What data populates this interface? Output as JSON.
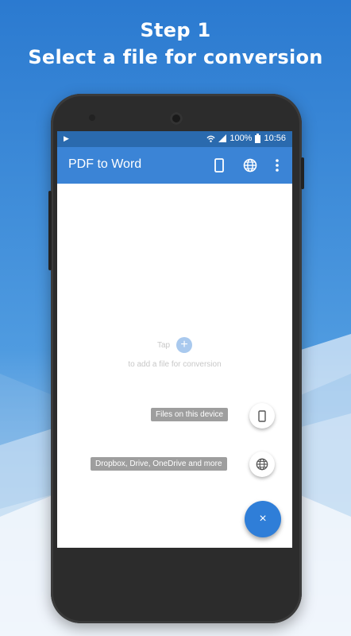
{
  "promo": {
    "step": "Step 1",
    "tagline": "Select a file for conversion"
  },
  "statusbar": {
    "battery": "100%",
    "time": "10:56"
  },
  "appbar": {
    "title": "PDF to Word"
  },
  "empty_state": {
    "tap": "Tap",
    "subtitle": "to add a file for conversion"
  },
  "fab_menu": {
    "device_label": "Files on this device",
    "cloud_label": "Dropbox, Drive, OneDrive and more",
    "close_symbol": "×"
  },
  "colors": {
    "appbar": "#3b84d6",
    "statusbar": "#2a6aae",
    "fab": "#2f7ed8"
  }
}
